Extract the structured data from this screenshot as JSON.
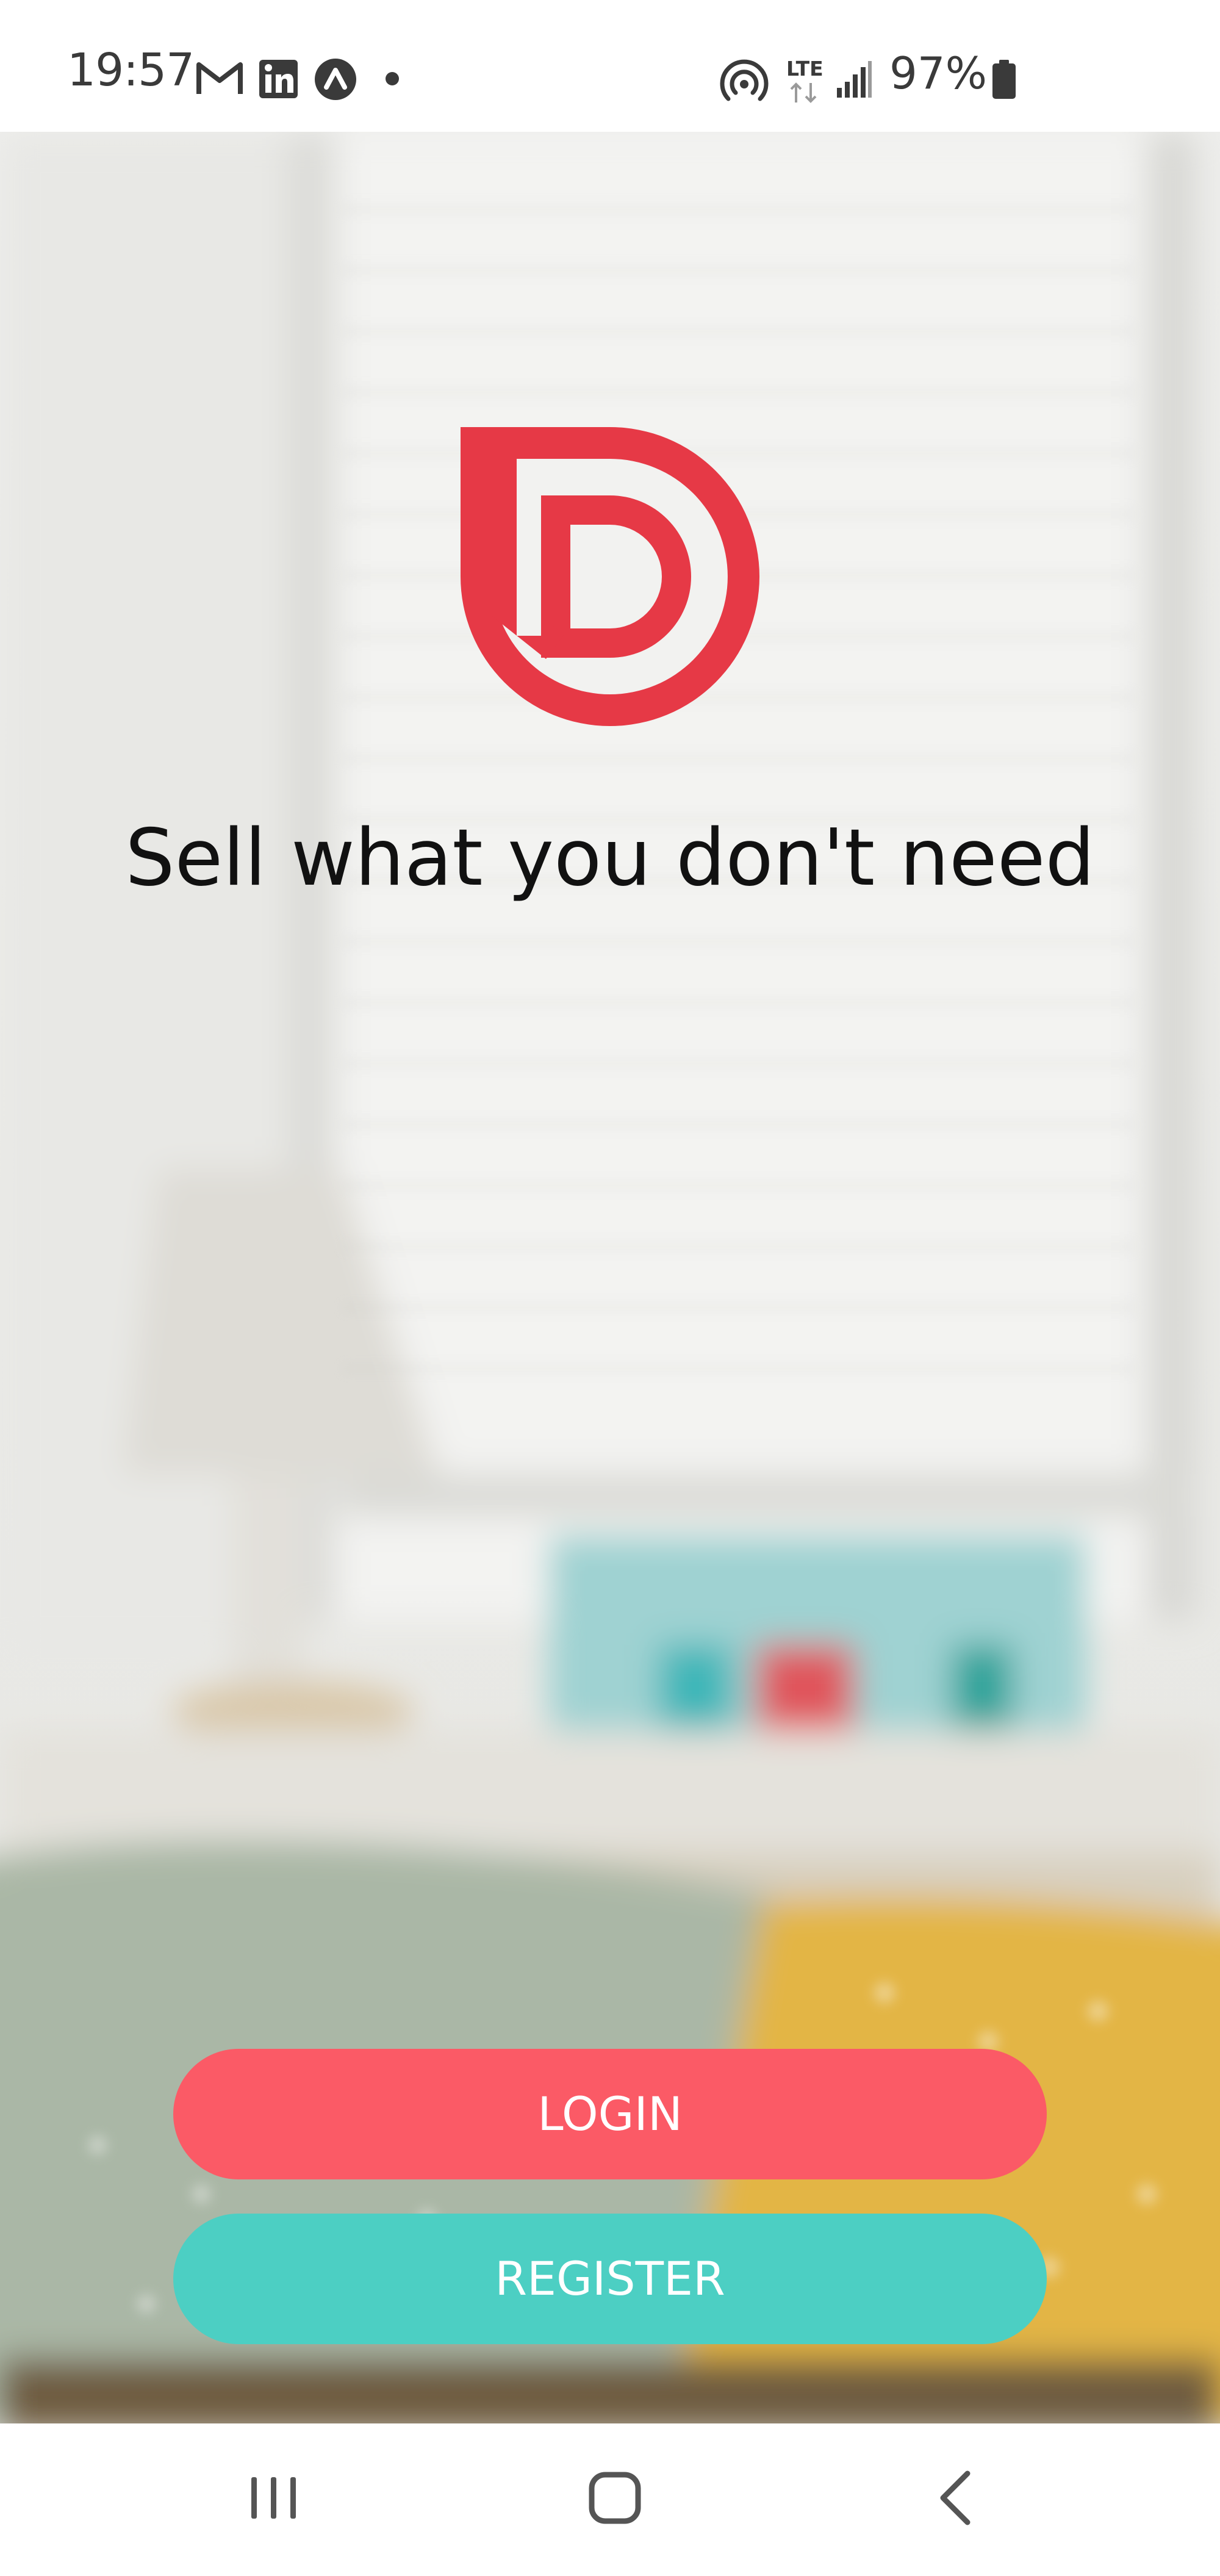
{
  "status_bar": {
    "time": "19:57",
    "notification_icons": [
      "gmail-icon",
      "linkedin-icon",
      "nova-launcher-icon",
      "more-notifications-dot"
    ],
    "system_icons": [
      "hotspot-icon",
      "lte-icon",
      "signal-icon",
      "battery-icon"
    ],
    "network_label": "LTE",
    "battery_percent": "97%"
  },
  "branding": {
    "logo_icon": "d-logo-icon",
    "tagline": "Sell what you don't need"
  },
  "actions": {
    "login_label": "LOGIN",
    "register_label": "REGISTER"
  },
  "nav_bar": {
    "icons": [
      "recents-icon",
      "home-icon",
      "back-icon"
    ]
  },
  "colors": {
    "brand_red": "#e63946",
    "login_button": "#fb5a66",
    "register_button": "#4ccfc3",
    "text_primary": "#111111"
  }
}
